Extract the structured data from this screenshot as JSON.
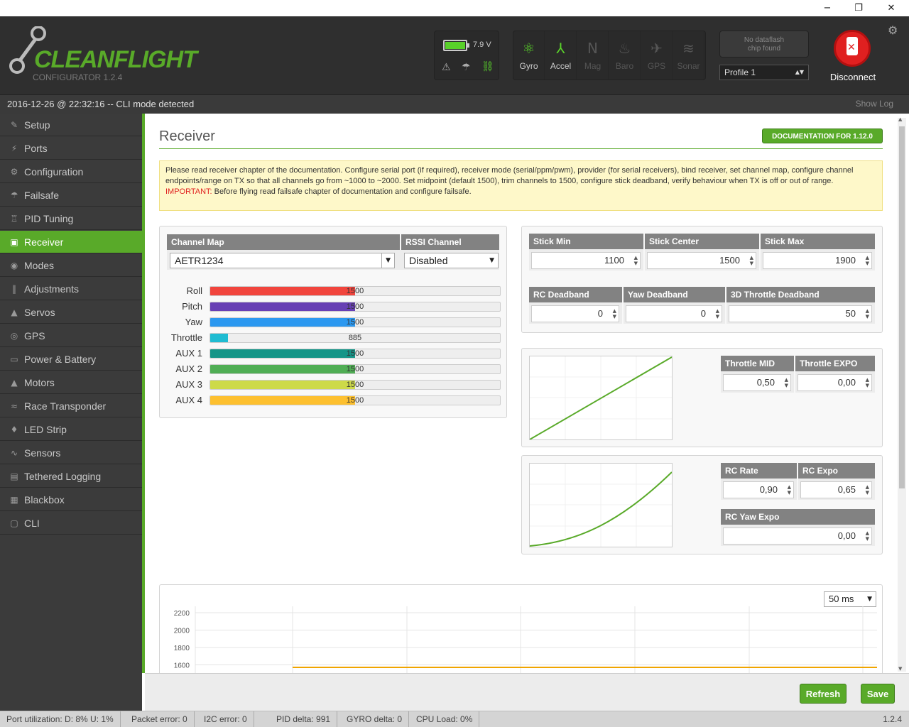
{
  "window": {
    "minimize": "−",
    "maximize": "❐",
    "close": "✕"
  },
  "header": {
    "logo": "CLEANFLIGHT",
    "version": "CONFIGURATOR  1.2.4",
    "voltage": "7.9 V",
    "sensors": [
      {
        "label": "Gyro",
        "active": true,
        "icon": "gyro-icon"
      },
      {
        "label": "Accel",
        "active": true,
        "icon": "accel-icon"
      },
      {
        "label": "Mag",
        "active": false,
        "icon": "mag-icon"
      },
      {
        "label": "Baro",
        "active": false,
        "icon": "baro-icon"
      },
      {
        "label": "GPS",
        "active": false,
        "icon": "gps-icon"
      },
      {
        "label": "Sonar",
        "active": false,
        "icon": "sonar-icon"
      }
    ],
    "dataflash": "No dataflash\nchip found",
    "profile": "Profile 1",
    "disconnect": "Disconnect"
  },
  "statusline": {
    "text": "2016-12-26 @ 22:32:16 -- CLI mode detected",
    "show_log": "Show Log"
  },
  "sidebar": [
    {
      "label": "Setup",
      "icon": "wrench-icon",
      "glyph": "✎"
    },
    {
      "label": "Ports",
      "icon": "plug-icon",
      "glyph": "⚡"
    },
    {
      "label": "Configuration",
      "icon": "gear-icon",
      "glyph": "⚙"
    },
    {
      "label": "Failsafe",
      "icon": "parachute-icon",
      "glyph": "☂"
    },
    {
      "label": "PID Tuning",
      "icon": "pid-icon",
      "glyph": "♖"
    },
    {
      "label": "Receiver",
      "icon": "receiver-icon",
      "glyph": "▣",
      "active": true
    },
    {
      "label": "Modes",
      "icon": "modes-icon",
      "glyph": "◉"
    },
    {
      "label": "Adjustments",
      "icon": "adjust-icon",
      "glyph": "‖"
    },
    {
      "label": "Servos",
      "icon": "servo-icon",
      "glyph": "▲"
    },
    {
      "label": "GPS",
      "icon": "gps-icon",
      "glyph": "◎"
    },
    {
      "label": "Power & Battery",
      "icon": "battery-icon",
      "glyph": "▭"
    },
    {
      "label": "Motors",
      "icon": "motor-icon",
      "glyph": "▲"
    },
    {
      "label": "Race Transponder",
      "icon": "transponder-icon",
      "glyph": "≈"
    },
    {
      "label": "LED Strip",
      "icon": "led-icon",
      "glyph": "♦"
    },
    {
      "label": "Sensors",
      "icon": "sensors-icon",
      "glyph": "∿"
    },
    {
      "label": "Tethered Logging",
      "icon": "log-icon",
      "glyph": "▤"
    },
    {
      "label": "Blackbox",
      "icon": "blackbox-icon",
      "glyph": "▦"
    },
    {
      "label": "CLI",
      "icon": "cli-icon",
      "glyph": "▢"
    }
  ],
  "page": {
    "title": "Receiver",
    "doc_button": "DOCUMENTATION FOR 1.12.0",
    "notice": "Please read receiver chapter of the documentation. Configure serial port (if required), receiver mode (serial/ppm/pwm), provider (for serial receivers), bind receiver, set channel map, configure channel endpoints/range on TX so that all channels go from ~1000 to ~2000. Set midpoint (default 1500), trim channels to 1500, configure stick deadband, verify behaviour when TX is off or out of range.",
    "important_label": "IMPORTANT:",
    "important_text": " Before flying read failsafe chapter of documentation and configure failsafe."
  },
  "channel_map": {
    "header": "Channel Map",
    "value": "AETR1234"
  },
  "rssi": {
    "header": "RSSI Channel",
    "value": "Disabled"
  },
  "channels": [
    {
      "name": "Roll",
      "value": 1500,
      "color": "#f1453d"
    },
    {
      "name": "Pitch",
      "value": 1500,
      "color": "#673fb4"
    },
    {
      "name": "Yaw",
      "value": 1500,
      "color": "#2b98f0"
    },
    {
      "name": "Throttle",
      "value": 885,
      "color": "#1fbcd2"
    },
    {
      "name": "AUX 1",
      "value": 1500,
      "color": "#159588"
    },
    {
      "name": "AUX 2",
      "value": 1500,
      "color": "#50ae55"
    },
    {
      "name": "AUX 3",
      "value": 1500,
      "color": "#cdda49"
    },
    {
      "name": "AUX 4",
      "value": 1500,
      "color": "#fdc02f"
    }
  ],
  "stick": {
    "headers": [
      "Stick Min",
      "Stick Center",
      "Stick Max"
    ],
    "values": [
      "1100",
      "1500",
      "1900"
    ]
  },
  "deadband": {
    "headers": [
      "RC Deadband",
      "Yaw Deadband",
      "3D Throttle Deadband"
    ],
    "values": [
      "0",
      "0",
      "50"
    ]
  },
  "throttle": {
    "headers": [
      "Throttle MID",
      "Throttle EXPO"
    ],
    "values": [
      "0,50",
      "0,00"
    ]
  },
  "rates": {
    "headers": [
      "RC Rate",
      "RC Expo"
    ],
    "values": [
      "0,90",
      "0,65"
    ],
    "yaw_header": "RC Yaw Expo",
    "yaw_value": "0,00"
  },
  "graph": {
    "interval": "50 ms",
    "ticks": [
      "2200",
      "2000",
      "1800",
      "1600"
    ],
    "line_color": "#f0a500"
  },
  "buttons": {
    "refresh": "Refresh",
    "save": "Save"
  },
  "statusbar": {
    "items": [
      "Port utilization: D: 8% U: 1%",
      "Packet error: 0",
      "I2C error: 0",
      "PID delta: 991",
      "GYRO delta: 0",
      "CPU Load: 0%"
    ],
    "version": "1.2.4"
  }
}
